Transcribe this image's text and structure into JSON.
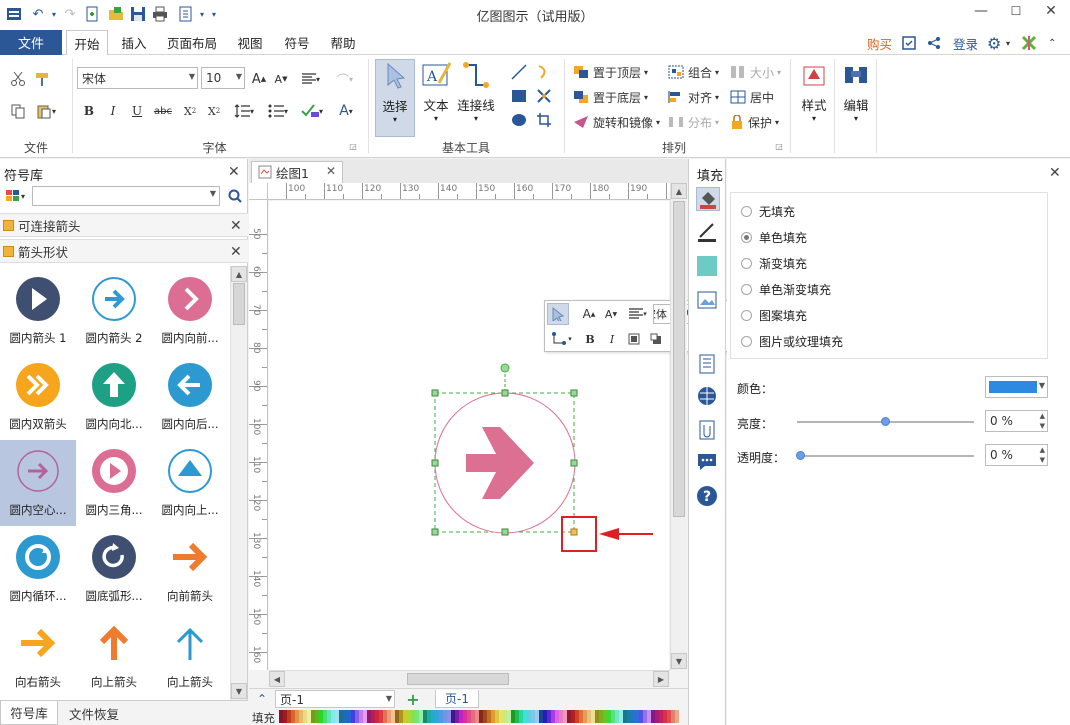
{
  "window": {
    "title": "亿图图示（试用版）"
  },
  "menu": {
    "file": "文件",
    "tabs": [
      "开始",
      "插入",
      "页面布局",
      "视图",
      "符号",
      "帮助"
    ],
    "buy": "购买",
    "login": "登录"
  },
  "ribbon": {
    "groups": {
      "file": "文件",
      "font": "字体",
      "basic_tools": "基本工具",
      "arrange": "排列"
    },
    "font_name": "宋体",
    "font_size": "10",
    "big_buttons": {
      "select": "选择",
      "text": "文本",
      "connector": "连接线",
      "style": "样式",
      "edit": "编辑"
    },
    "arrange": {
      "bring_front": "置于顶层",
      "send_back": "置于底层",
      "rotate": "旋转和镜像",
      "group": "组合",
      "align": "对齐",
      "distribute": "分布",
      "size": "大小",
      "center": "居中",
      "protect": "保护"
    }
  },
  "left_panel": {
    "title": "符号库",
    "libraries": [
      "可连接箭头",
      "箭头形状"
    ],
    "shapes": [
      {
        "label": "圆内箭头 1"
      },
      {
        "label": "圆内箭头 2"
      },
      {
        "label": "圆内向前..."
      },
      {
        "label": "圆内双箭头"
      },
      {
        "label": "圆内向北..."
      },
      {
        "label": "圆内向后..."
      },
      {
        "label": "圆内空心..."
      },
      {
        "label": "圆内三角..."
      },
      {
        "label": "圆内向上..."
      },
      {
        "label": "圆内循环..."
      },
      {
        "label": "圆底弧形..."
      },
      {
        "label": "向前箭头"
      },
      {
        "label": "向右箭头"
      },
      {
        "label": "向上箭头"
      },
      {
        "label": "向上箭头"
      }
    ],
    "bottom_tabs": [
      "符号库",
      "文件恢复"
    ]
  },
  "document": {
    "tab": "绘图1",
    "hruler": [
      "100",
      "110",
      "120",
      "130",
      "140",
      "150",
      "160",
      "170",
      "180",
      "190"
    ],
    "vruler": [
      "50",
      "60",
      "70",
      "80",
      "90",
      "100",
      "110",
      "120",
      "130",
      "140",
      "150",
      "160"
    ],
    "page_select": "页-1",
    "page_tab": "页-1",
    "fill_label": "填充"
  },
  "mini_toolbar": {
    "font": "宋体"
  },
  "fill_panel": {
    "title": "填充",
    "options": [
      "无填充",
      "单色填充",
      "渐变填充",
      "单色渐变填充",
      "图案填充",
      "图片或纹理填充"
    ],
    "selected_option": "单色填充",
    "color_label": "颜色：",
    "brightness_label": "亮度：",
    "brightness_value": "0 %",
    "transparency_label": "透明度：",
    "transparency_value": "0 %"
  },
  "colors": {
    "brand": "#2b5797",
    "arrow_pink": "#db7093",
    "fill_color": "#2e8ae0",
    "annotation_red": "#e02020"
  },
  "icons": [
    "undo-icon",
    "redo-icon",
    "save-icon",
    "print-icon",
    "search-icon",
    "gear-icon",
    "share-icon",
    "close-icon",
    "help-icon"
  ]
}
